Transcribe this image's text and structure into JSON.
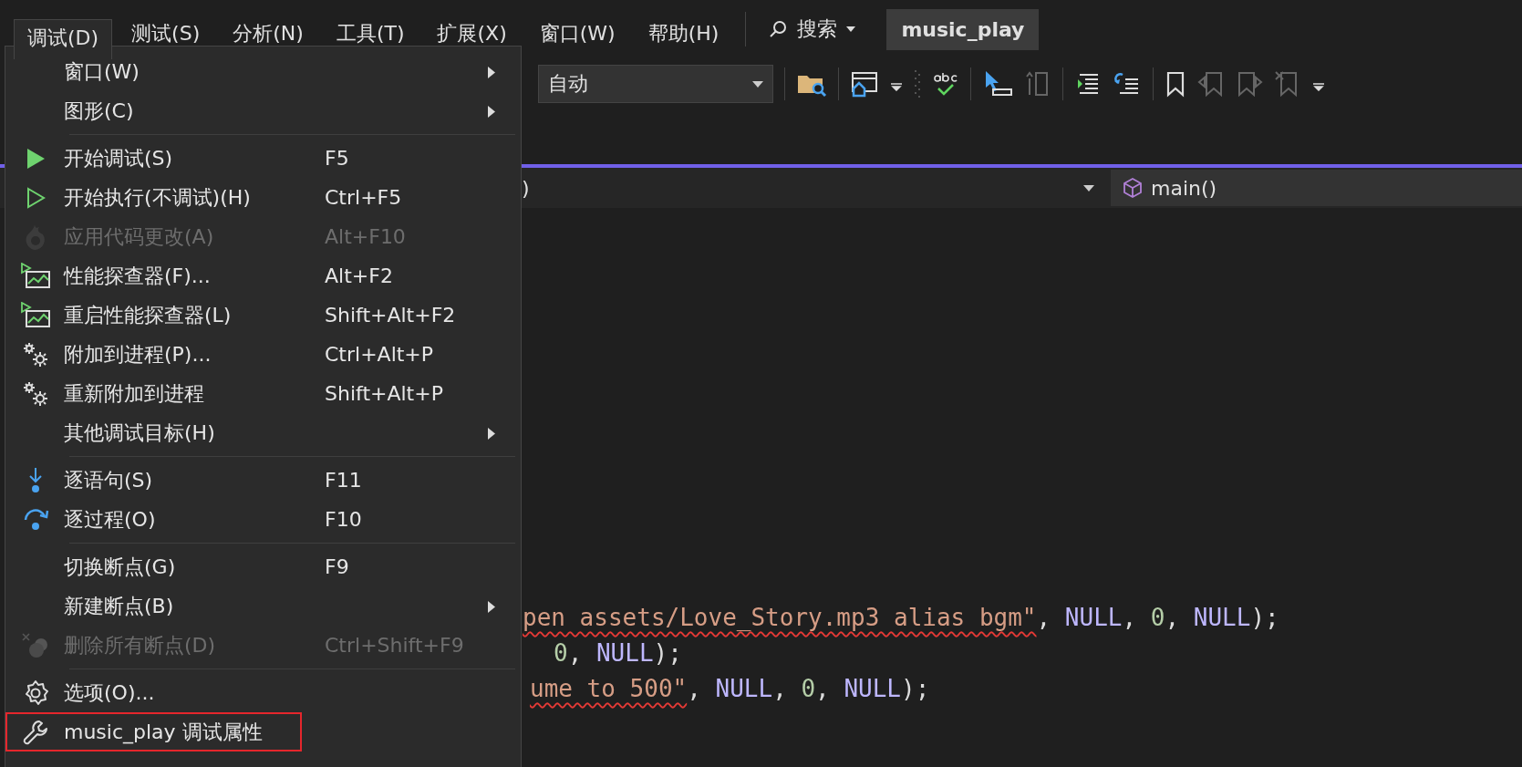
{
  "menubar": [
    {
      "label": "调试(D)",
      "selected": true
    },
    {
      "label": "测试(S)",
      "selected": false
    },
    {
      "label": "分析(N)",
      "selected": false
    },
    {
      "label": "工具(T)",
      "selected": false
    },
    {
      "label": "扩展(X)",
      "selected": false
    },
    {
      "label": "窗口(W)",
      "selected": false
    },
    {
      "label": "帮助(H)",
      "selected": false
    }
  ],
  "search": {
    "label": "搜索"
  },
  "project_title": "music_play",
  "toolbar": {
    "config_combo": "自动"
  },
  "editor": {
    "scope_combo": ")",
    "function_combo": "main()",
    "code_lines": [
      [
        {
          "kind": "string",
          "text": "pen assets/Love_Story.mp3 alias bgm\"",
          "squiggle": true
        },
        {
          "kind": "punct",
          "text": ", "
        },
        {
          "kind": "macro",
          "text": "NULL"
        },
        {
          "kind": "punct",
          "text": ", "
        },
        {
          "kind": "number",
          "text": "0"
        },
        {
          "kind": "punct",
          "text": ", "
        },
        {
          "kind": "macro",
          "text": "NULL"
        },
        {
          "kind": "punct",
          "text": ");"
        }
      ],
      [
        {
          "kind": "number",
          "text": "0"
        },
        {
          "kind": "punct",
          "text": ", "
        },
        {
          "kind": "macro",
          "text": "NULL"
        },
        {
          "kind": "punct",
          "text": ");"
        }
      ],
      [
        {
          "kind": "string",
          "text": "ume to 500\"",
          "squiggle": true
        },
        {
          "kind": "punct",
          "text": ", "
        },
        {
          "kind": "macro",
          "text": "NULL"
        },
        {
          "kind": "punct",
          "text": ", "
        },
        {
          "kind": "number",
          "text": "0"
        },
        {
          "kind": "punct",
          "text": ", "
        },
        {
          "kind": "macro",
          "text": "NULL"
        },
        {
          "kind": "punct",
          "text": ");"
        }
      ]
    ]
  },
  "debug_menu": {
    "groups": [
      [
        {
          "label": "窗口(W)",
          "submenu": true,
          "disabled": false
        },
        {
          "label": "图形(C)",
          "submenu": true,
          "disabled": false
        }
      ],
      [
        {
          "label": "开始调试(S)",
          "shortcut": "F5",
          "submenu": false,
          "disabled": false
        },
        {
          "label": "开始执行(不调试)(H)",
          "shortcut": "Ctrl+F5",
          "submenu": false,
          "disabled": false
        },
        {
          "label": "应用代码更改(A)",
          "shortcut": "Alt+F10",
          "submenu": false,
          "disabled": true
        },
        {
          "label": "性能探查器(F)...",
          "shortcut": "Alt+F2",
          "submenu": false,
          "disabled": false
        },
        {
          "label": "重启性能探查器(L)",
          "shortcut": "Shift+Alt+F2",
          "submenu": false,
          "disabled": false
        },
        {
          "label": "附加到进程(P)...",
          "shortcut": "Ctrl+Alt+P",
          "submenu": false,
          "disabled": false
        },
        {
          "label": "重新附加到进程",
          "shortcut": "Shift+Alt+P",
          "submenu": false,
          "disabled": false
        },
        {
          "label": "其他调试目标(H)",
          "submenu": true,
          "disabled": false
        }
      ],
      [
        {
          "label": "逐语句(S)",
          "shortcut": "F11",
          "submenu": false,
          "disabled": false
        },
        {
          "label": "逐过程(O)",
          "shortcut": "F10",
          "submenu": false,
          "disabled": false
        }
      ],
      [
        {
          "label": "切换断点(G)",
          "shortcut": "F9",
          "submenu": false,
          "disabled": false
        },
        {
          "label": "新建断点(B)",
          "submenu": true,
          "disabled": false
        },
        {
          "label": "删除所有断点(D)",
          "shortcut": "Ctrl+Shift+F9",
          "submenu": false,
          "disabled": true
        }
      ],
      [
        {
          "label": "选项(O)...",
          "submenu": false,
          "disabled": false
        },
        {
          "label": "music_play 调试属性",
          "submenu": false,
          "disabled": false,
          "highlighted": true
        }
      ]
    ]
  }
}
